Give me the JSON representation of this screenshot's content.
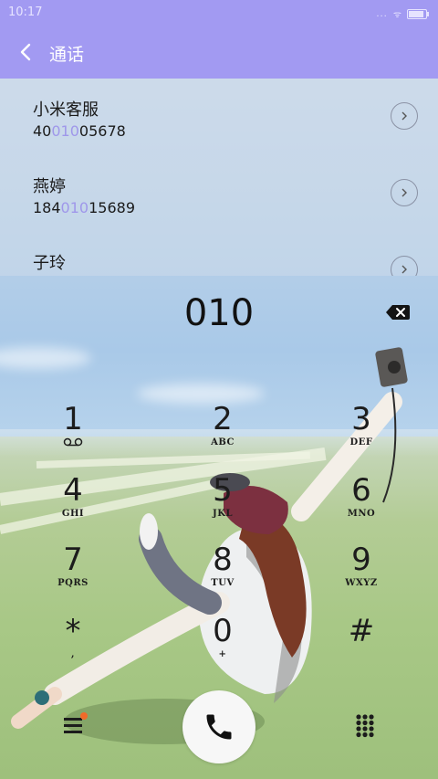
{
  "status": {
    "time": "10:17",
    "signal": "...",
    "battery_level": 0.9
  },
  "header": {
    "back_icon": "back-arrow-icon",
    "title": "通话"
  },
  "suggestions": [
    {
      "name": "小米客服",
      "num_pre": "40",
      "num_match": "010",
      "num_post": "05678"
    },
    {
      "name": "燕婷",
      "num_pre": "184",
      "num_match": "010",
      "num_post": "15689"
    },
    {
      "name": "子玲"
    }
  ],
  "dialer": {
    "digits": "010",
    "delete_icon": "backspace-icon",
    "keys": [
      {
        "digit": "1",
        "letters": ""
      },
      {
        "digit": "2",
        "letters": "ABC"
      },
      {
        "digit": "3",
        "letters": "DEF"
      },
      {
        "digit": "4",
        "letters": "GHI"
      },
      {
        "digit": "5",
        "letters": "JKL"
      },
      {
        "digit": "6",
        "letters": "MNO"
      },
      {
        "digit": "7",
        "letters": "PQRS"
      },
      {
        "digit": "8",
        "letters": "TUV"
      },
      {
        "digit": "9",
        "letters": "WXYZ"
      },
      {
        "digit": "*",
        "letters": ","
      },
      {
        "digit": "0",
        "letters": "+"
      },
      {
        "digit": "#",
        "letters": ""
      }
    ]
  },
  "bottom_bar": {
    "menu_icon": "menu-icon",
    "call_icon": "phone-icon",
    "keypad_icon": "dialpad-icon",
    "badge_color": "#f06a2a"
  },
  "colors": {
    "accent": "#a29af2",
    "match_highlight": "#9f97ea"
  }
}
